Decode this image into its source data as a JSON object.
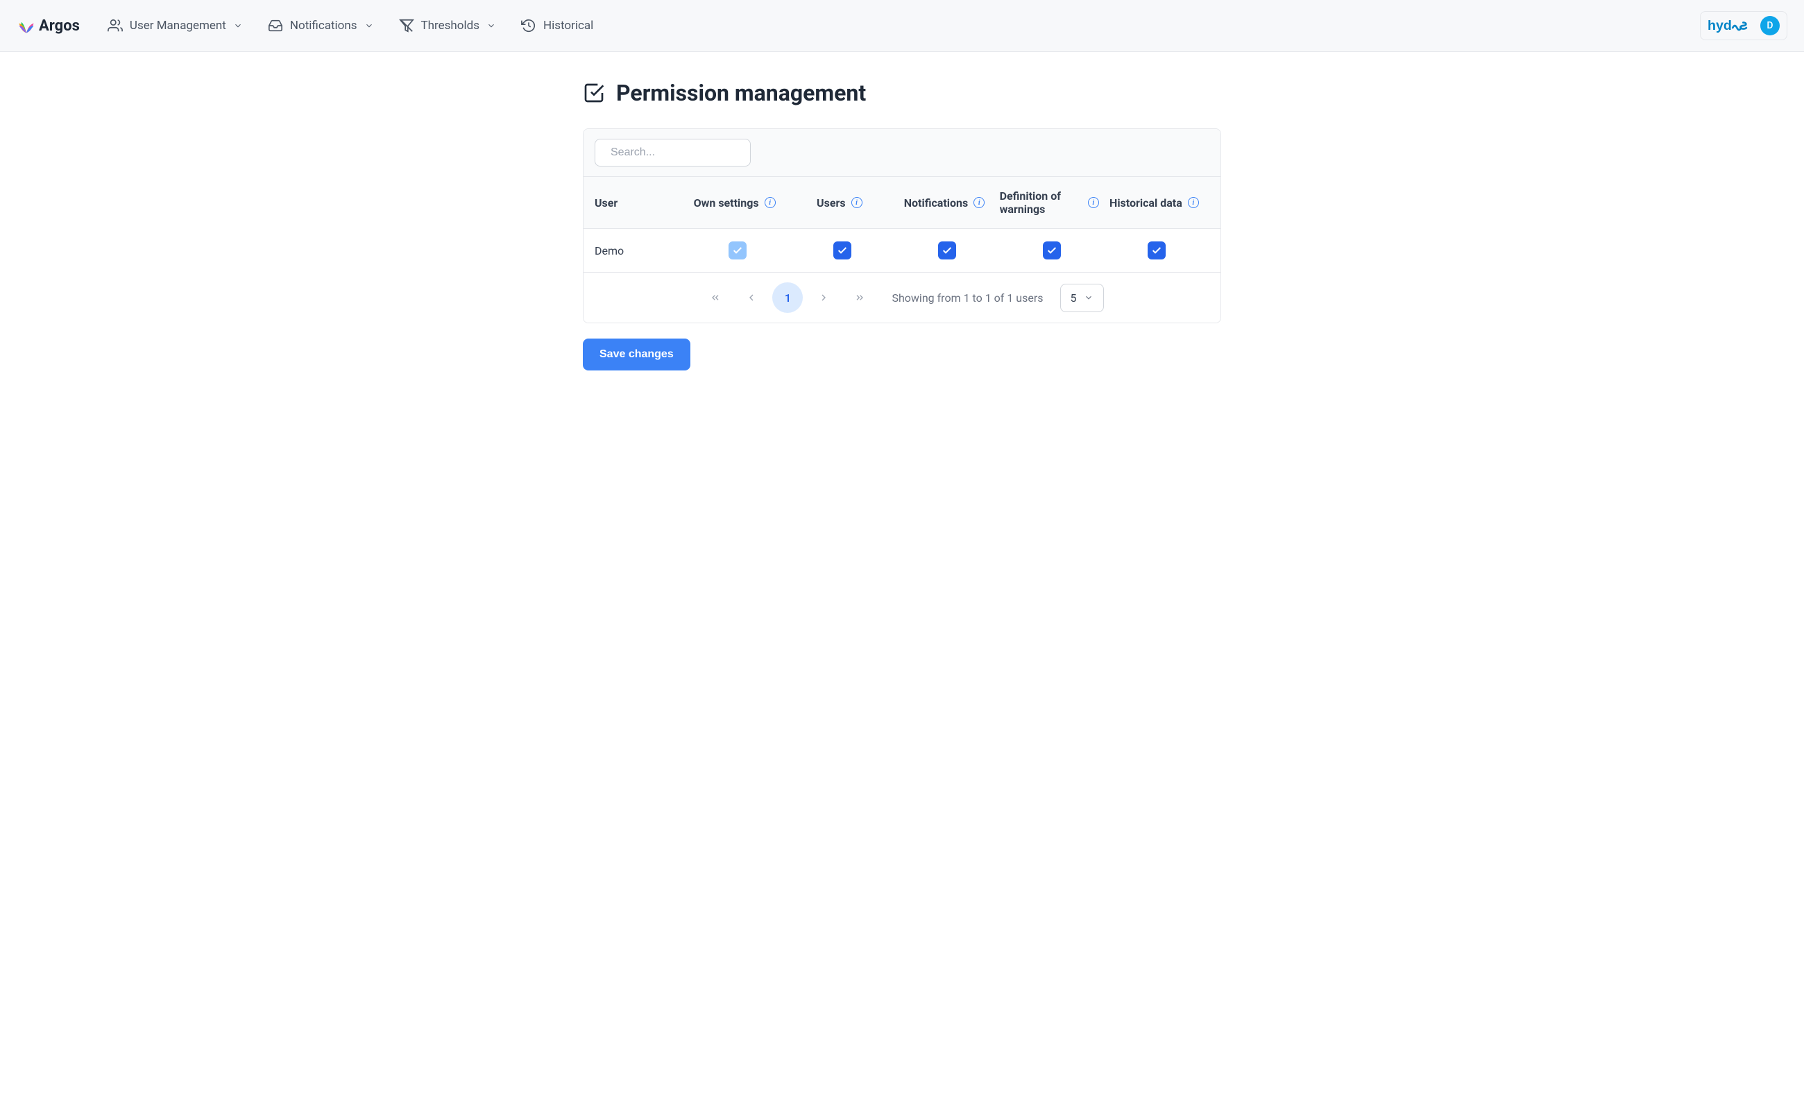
{
  "logo": {
    "text": "Argos"
  },
  "nav": {
    "user_management": "User Management",
    "notifications": "Notifications",
    "thresholds": "Thresholds",
    "historical": "Historical"
  },
  "header_right": {
    "brand": "hydus",
    "avatar_letter": "D"
  },
  "page": {
    "title": "Permission management"
  },
  "search": {
    "placeholder": "Search..."
  },
  "table": {
    "headers": {
      "user": "User",
      "own_settings": "Own settings",
      "users": "Users",
      "notifications": "Notifications",
      "definition_of_warnings": "Definition of warnings",
      "historical_data": "Historical data"
    },
    "rows": [
      {
        "user": "Demo",
        "own_settings": true,
        "own_settings_disabled": true,
        "users": true,
        "notifications": true,
        "definition_of_warnings": true,
        "historical_data": true
      }
    ]
  },
  "pagination": {
    "current_page": "1",
    "info": "Showing from 1 to 1 of 1 users",
    "page_size": "5"
  },
  "buttons": {
    "save": "Save changes"
  }
}
